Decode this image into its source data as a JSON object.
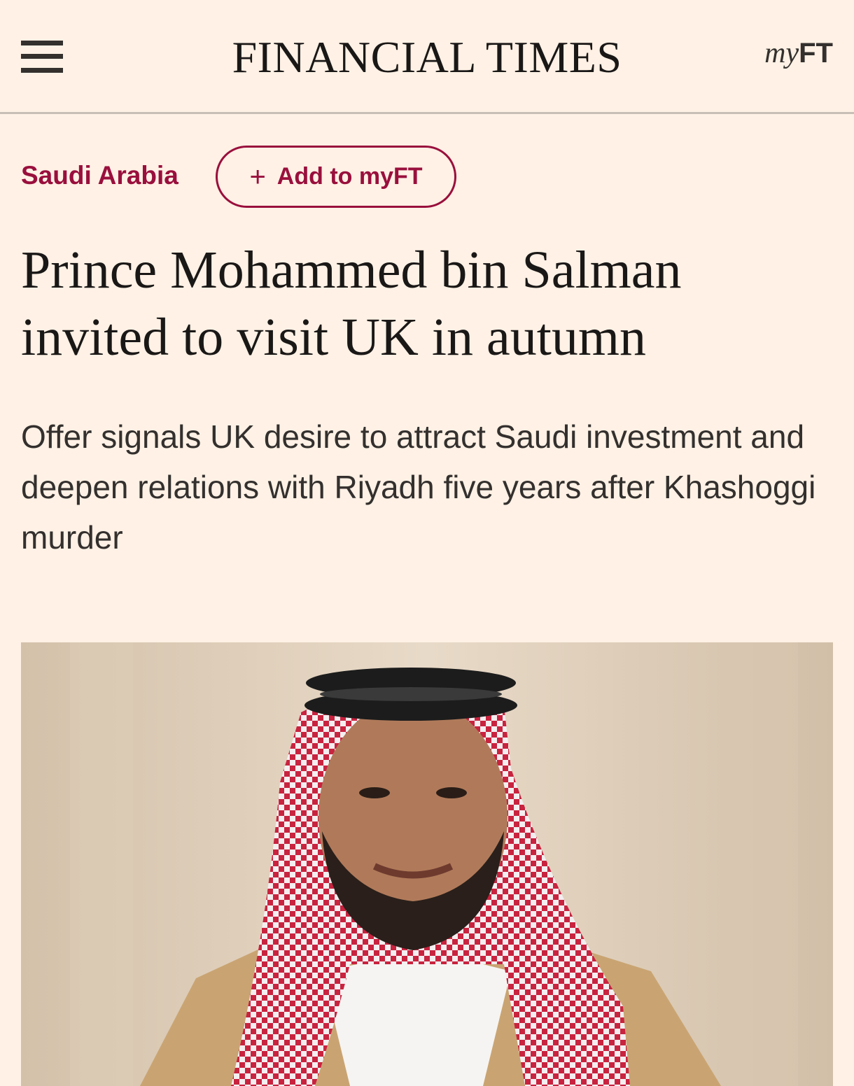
{
  "header": {
    "masthead": "FINANCIAL TIMES",
    "myft_my": "my",
    "myft_ft": "FT"
  },
  "article": {
    "topic": "Saudi Arabia",
    "follow_plus": "+",
    "follow_label": "Add to myFT",
    "headline": "Prince Mohammed bin Salman invited to visit UK in autumn",
    "standfirst": "Offer signals UK desire to attract Saudi investment and deepen relations with Riyadh five years after Khashoggi murder"
  },
  "icons": {
    "menu": "hamburger-menu-icon",
    "plus": "plus-icon"
  },
  "colors": {
    "background": "#fff1e5",
    "accent": "#990f3d",
    "text": "#1a1817"
  }
}
